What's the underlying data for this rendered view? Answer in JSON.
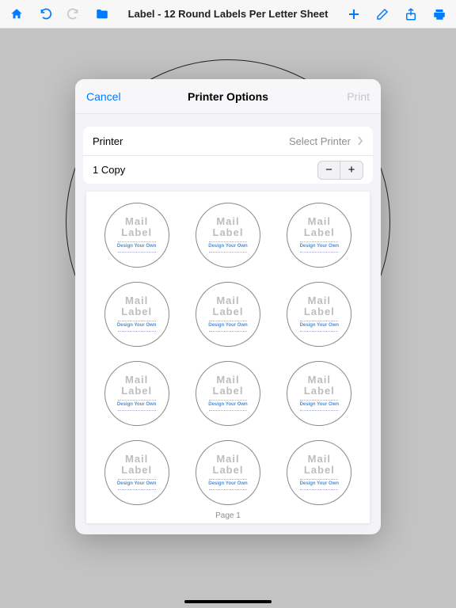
{
  "toolbar": {
    "title": "Label - 12 Round Labels Per Letter Sheet"
  },
  "modal": {
    "cancel": "Cancel",
    "title": "Printer Options",
    "print": "Print",
    "printer_label": "Printer",
    "printer_value": "Select Printer",
    "copies_label": "1 Copy"
  },
  "label": {
    "line1": "Mail",
    "line2": "Label",
    "line3": "Design Your Own"
  },
  "page_label": "Page 1",
  "colors": {
    "accent": "#007aff"
  }
}
